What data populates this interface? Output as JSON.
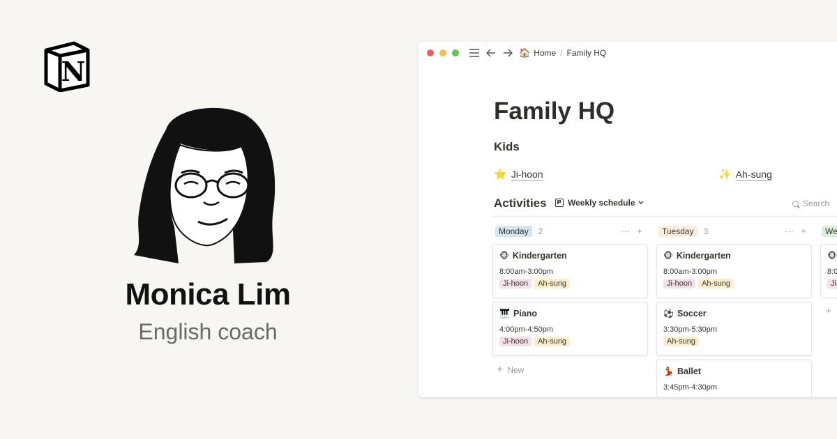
{
  "profile": {
    "name": "Monica Lim",
    "role": "English coach"
  },
  "logo": {
    "letter": "N"
  },
  "window": {
    "breadcrumb": {
      "home_emoji": "🏠",
      "home": "Home",
      "separator": "/",
      "page": "Family HQ"
    },
    "title": "Family HQ",
    "kids_heading": "Kids",
    "kids": [
      {
        "emoji": "⭐",
        "name": "Ji-hoon"
      },
      {
        "emoji": "✨",
        "name": "Ah-sung"
      }
    ],
    "activities_heading": "Activities",
    "view_label": "Weekly schedule",
    "search_label": "Search",
    "columns": [
      {
        "day": "Monday",
        "count": "2",
        "color": "#d3e5ef"
      },
      {
        "day": "Tuesday",
        "count": "3",
        "color": "#fbecdd"
      },
      {
        "day": "We",
        "color": "#dbeddb"
      }
    ],
    "col_actions": {
      "more": "···",
      "add": "+"
    },
    "cards": {
      "mon_1": {
        "emoji": "🐵",
        "title": "Kindergarten",
        "time": "8:00am-3:00pm",
        "tags": [
          "Ji-hoon",
          "Ah-sung"
        ]
      },
      "mon_2": {
        "emoji": "🎹",
        "title": "Piano",
        "time": "4:00pm-4:50pm",
        "tags": [
          "Ji-hoon",
          "Ah-sung"
        ]
      },
      "tue_1": {
        "emoji": "🐵",
        "title": "Kindergarten",
        "time": "8:00am-3:00pm",
        "tags": [
          "Ji-hoon",
          "Ah-sung"
        ]
      },
      "tue_2": {
        "emoji": "⚽",
        "title": "Soccer",
        "time": "3:30pm-5:30pm",
        "tags": [
          "Ah-sung"
        ]
      },
      "tue_3": {
        "emoji": "💃",
        "title": "Ballet",
        "time": "3:45pm-4:30pm"
      },
      "wed_1": {
        "emoji": "🐵",
        "time": "8:0",
        "tag": "Ji-"
      }
    },
    "new_label": "New"
  }
}
